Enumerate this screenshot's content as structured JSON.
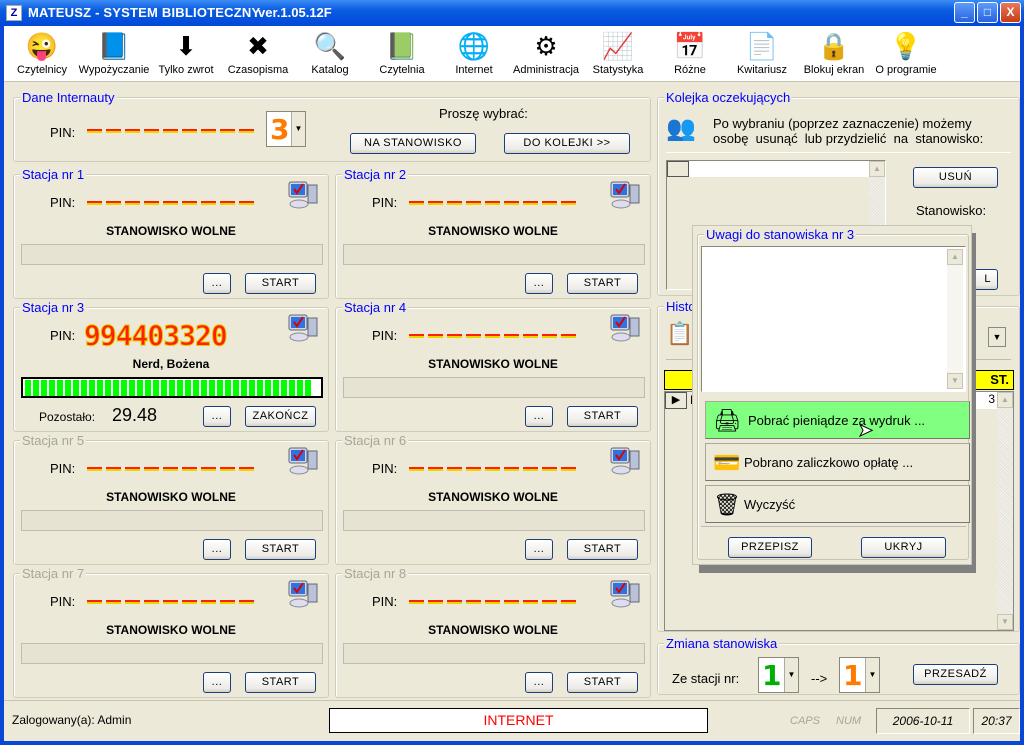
{
  "window": {
    "title": "MATEUSZ - SYSTEM BIBLIOTECZNY",
    "version": "ver.1.05.12F",
    "minimize": "_",
    "maximize": "□",
    "close": "X"
  },
  "toolbar": [
    {
      "label": "Czytelnicy",
      "icon": "smiley-icon",
      "glyph": "😜"
    },
    {
      "label": "Wypożyczanie",
      "icon": "book-lend-icon",
      "glyph": "📘"
    },
    {
      "label": "Tylko zwrot",
      "icon": "return-arrow-icon",
      "glyph": "⬇"
    },
    {
      "label": "Czasopisma",
      "icon": "red-x-icon",
      "glyph": "✖"
    },
    {
      "label": "Katalog",
      "icon": "magnifier-icon",
      "glyph": "🔍"
    },
    {
      "label": "Czytelnia",
      "icon": "book-icon",
      "glyph": "📗"
    },
    {
      "label": "Internet",
      "icon": "globe-icon",
      "glyph": "🌐"
    },
    {
      "label": "Administracja",
      "icon": "gears-icon",
      "glyph": "⚙"
    },
    {
      "label": "Statystyka",
      "icon": "chart-icon",
      "glyph": "📈"
    },
    {
      "label": "Różne",
      "icon": "calendar-check-icon",
      "glyph": "📅"
    },
    {
      "label": "Kwitariusz",
      "icon": "documents-icon",
      "glyph": "📄"
    },
    {
      "label": "Blokuj ekran",
      "icon": "padlock-icon",
      "glyph": "🔒"
    },
    {
      "label": "O programie",
      "icon": "lightbulb-icon",
      "glyph": "💡"
    }
  ],
  "internaut": {
    "title": "Dane Internauty",
    "pin_label": "PIN:",
    "station_select": "3",
    "prompt": "Proszę wybrać:",
    "to_station": "NA STANOWISKO",
    "to_queue": "DO KOLEJKI >>"
  },
  "stations": [
    {
      "title": "Stacja nr 1",
      "pin_label": "PIN:",
      "status": "STANOWISKO WOLNE",
      "more": "...",
      "action": "START",
      "enabled": true
    },
    {
      "title": "Stacja nr 2",
      "pin_label": "PIN:",
      "status": "STANOWISKO WOLNE",
      "more": "...",
      "action": "START",
      "enabled": true
    },
    {
      "title": "Stacja nr 3",
      "pin_label": "PIN:",
      "pin": "994403320",
      "status": "Nerd, Bożena",
      "more": "...",
      "action": "ZAKOŃCZ",
      "enabled": true,
      "progress": 1.0,
      "remaining_label": "Pozostało:",
      "remaining": "29.48"
    },
    {
      "title": "Stacja nr 4",
      "pin_label": "PIN:",
      "status": "STANOWISKO WOLNE",
      "more": "...",
      "action": "START",
      "enabled": true
    },
    {
      "title": "Stacja nr 5",
      "pin_label": "PIN:",
      "status": "STANOWISKO WOLNE",
      "more": "...",
      "action": "START",
      "enabled": false
    },
    {
      "title": "Stacja nr 6",
      "pin_label": "PIN:",
      "status": "STANOWISKO WOLNE",
      "more": "...",
      "action": "START",
      "enabled": false
    },
    {
      "title": "Stacja nr 7",
      "pin_label": "PIN:",
      "status": "STANOWISKO WOLNE",
      "more": "...",
      "action": "START",
      "enabled": false
    },
    {
      "title": "Stacja nr 8",
      "pin_label": "PIN:",
      "status": "STANOWISKO WOLNE",
      "more": "...",
      "action": "START",
      "enabled": false
    }
  ],
  "queue": {
    "title": "Kolejka oczekujących",
    "info_line1": "Po wybraniu (poprzez zaznaczenie) możemy",
    "info_line2": "osobę  usunąć  lub przydzielić  na  stanowisko:",
    "remove": "USUŃ",
    "station_label": "Stanowisko:",
    "assign_partial": "L"
  },
  "history": {
    "title_partial": "Histo",
    "column_partial": "ST.",
    "cell_partial": "3",
    "row_partial": "N"
  },
  "popup": {
    "title": "Uwagi do stanowiska nr 3",
    "notes": "",
    "items": [
      {
        "label": "Pobrać pieniądze za wydruk ...",
        "icon": "printer-icon",
        "highlighted": true
      },
      {
        "label": "Pobrano zaliczkowo opłatę ...",
        "icon": "payment-card-icon",
        "highlighted": false
      },
      {
        "label": "Wyczyść",
        "icon": "wastebasket-icon",
        "highlighted": false
      }
    ],
    "copy": "PRZEPISZ",
    "hide": "UKRYJ"
  },
  "change": {
    "title": "Zmiana stanowiska",
    "from_label": "Ze stacji nr:",
    "from": "1",
    "arrow": "-->",
    "to": "1",
    "move": "PRZESADŹ"
  },
  "statusbar": {
    "user": "Zalogowany(a): Admin",
    "mode": "INTERNET",
    "caps": "CAPS",
    "num": "NUM",
    "date": "2006-10-11",
    "time": "20:37"
  },
  "colors": {
    "title_blue": "#0000ff",
    "pin_red": "#ff2000",
    "progress_green": "#00ff00",
    "highlight_green": "#80ff80",
    "header_yellow": "#ffff00",
    "from_green": "#00b000",
    "to_orange": "#ff7a00"
  }
}
